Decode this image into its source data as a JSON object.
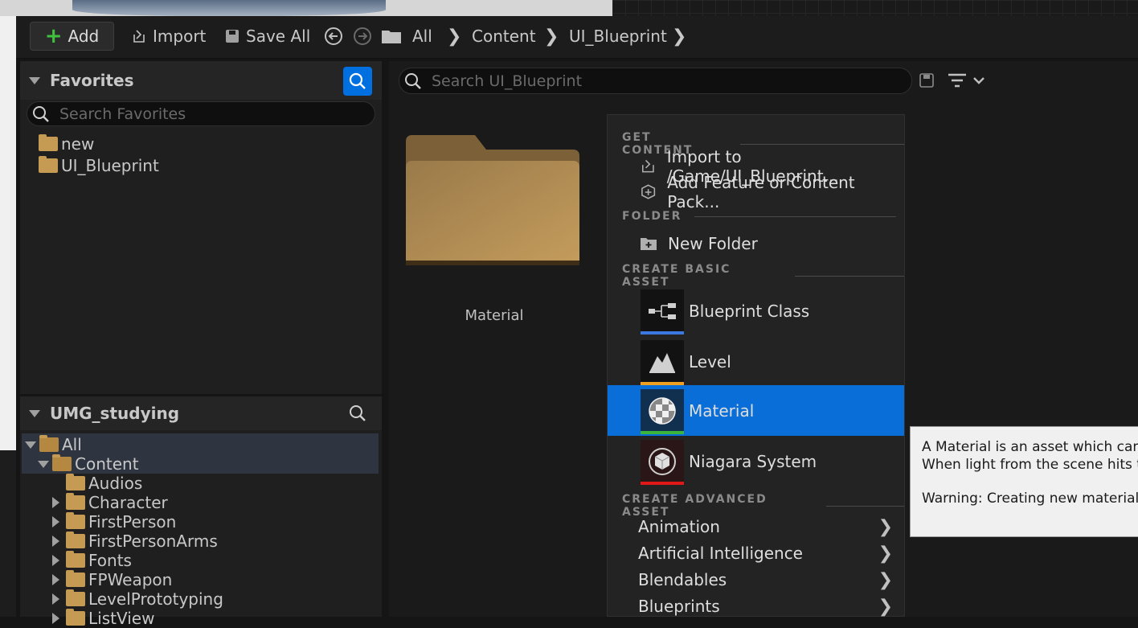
{
  "toolbar": {
    "add_label": "Add",
    "import_label": "Import",
    "save_all_label": "Save All",
    "breadcrumb": [
      "All",
      "Content",
      "UI_Blueprint"
    ]
  },
  "favorites": {
    "title": "Favorites",
    "search_placeholder": "Search Favorites",
    "items": [
      "new",
      "UI_Blueprint"
    ]
  },
  "project_tree": {
    "title": "UMG_studying",
    "root": "All",
    "content": "Content",
    "folders": [
      "Audios",
      "Character",
      "FirstPerson",
      "FirstPersonArms",
      "Fonts",
      "FPWeapon",
      "LevelPrototyping",
      "ListView"
    ]
  },
  "content_browser": {
    "search_placeholder": "Search UI_Blueprint",
    "assets": [
      {
        "label": "Material",
        "type": "folder"
      }
    ]
  },
  "context_menu": {
    "sections": {
      "get_content": "GET CONTENT",
      "folder": "FOLDER",
      "create_basic": "CREATE BASIC ASSET",
      "create_advanced": "CREATE ADVANCED ASSET"
    },
    "get_content_items": [
      "Import to /Game/UI_Blueprint...",
      "Add Feature or Content Pack..."
    ],
    "folder_items": [
      "New Folder"
    ],
    "basic_assets": [
      {
        "label": "Blueprint Class",
        "color": "#3b78e0"
      },
      {
        "label": "Level",
        "color": "#f0a020"
      },
      {
        "label": "Material",
        "color": "#3cb43c"
      },
      {
        "label": "Niagara System",
        "color": "#e01818"
      }
    ],
    "advanced_assets": [
      "Animation",
      "Artificial Intelligence",
      "Blendables",
      "Blueprints"
    ],
    "highlighted": "Material"
  },
  "tooltip": {
    "line1": "A Material is an asset which can b",
    "line2": "When light from the scene hits the",
    "line3": "Warning: Creating new materials c"
  },
  "colors": {
    "accent": "#0070e0",
    "folder": "#c59a52"
  }
}
